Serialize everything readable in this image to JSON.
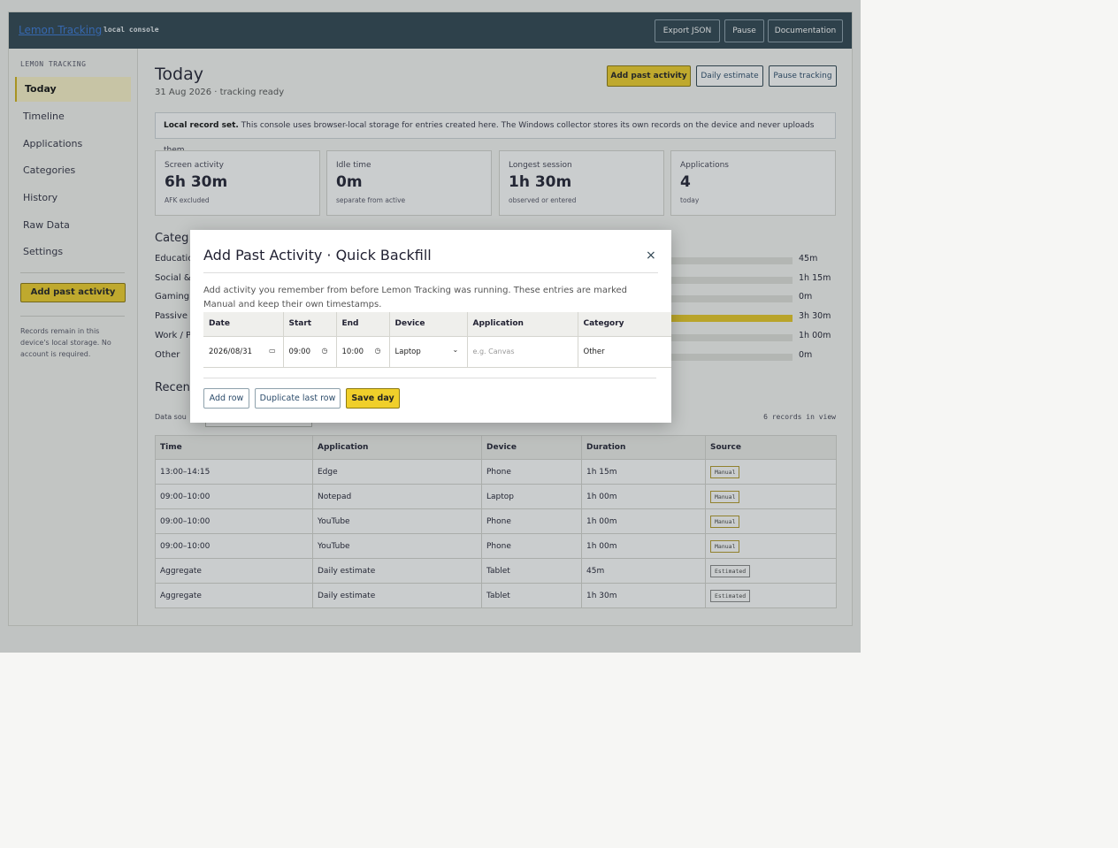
{
  "topbar": {
    "brand": "Lemon Tracking",
    "subtitle": "local console",
    "buttons": [
      "Export JSON",
      "Pause",
      "Documentation"
    ]
  },
  "sidebar": {
    "title": "LEMON TRACKING",
    "items": [
      {
        "label": "Today",
        "active": true
      },
      {
        "label": "Timeline"
      },
      {
        "label": "Applications"
      },
      {
        "label": "Categories"
      },
      {
        "label": "History"
      },
      {
        "label": "Raw Data"
      },
      {
        "label": "Settings"
      }
    ],
    "cta": "Add past activity",
    "note": "Records remain in this device's local storage. No account is required."
  },
  "header": {
    "title": "Today",
    "subtitle": "31 Aug 2026 · tracking ready",
    "buttons": [
      "Add past activity",
      "Daily estimate",
      "Pause tracking"
    ]
  },
  "notice": {
    "bold": "Local record set.",
    "text": " This console uses browser-local storage for entries created here. The Windows collector stores its own records on the device and never uploads them."
  },
  "stats": [
    {
      "label": "Screen activity",
      "value": "6h 30m",
      "sub": "AFK excluded"
    },
    {
      "label": "Idle time",
      "value": "0m",
      "sub": "separate from active"
    },
    {
      "label": "Longest session",
      "value": "1h 30m",
      "sub": "observed or entered"
    },
    {
      "label": "Applications",
      "value": "4",
      "sub": "today"
    }
  ],
  "categories": {
    "title": "Categ",
    "rows": [
      {
        "name": "Educatio",
        "amount": "45m",
        "fraction": 0
      },
      {
        "name": "Social &",
        "amount": "1h 15m",
        "fraction": 0
      },
      {
        "name": "Gaming",
        "amount": "0m",
        "fraction": 0
      },
      {
        "name": "Passive E",
        "amount": "3h 30m",
        "fraction": 1
      },
      {
        "name": "Work / P",
        "amount": "1h 00m",
        "fraction": 0
      },
      {
        "name": "Other",
        "amount": "0m",
        "fraction": 0
      }
    ]
  },
  "recent": {
    "title": "Recen",
    "filter_label": "Data sou",
    "count": "6 records in view",
    "columns": [
      "Time",
      "Application",
      "Device",
      "Duration",
      "Source"
    ],
    "rows": [
      [
        "13:00–14:15",
        "Edge",
        "Phone",
        "1h 15m",
        "Manual"
      ],
      [
        "09:00–10:00",
        "Notepad",
        "Laptop",
        "1h 00m",
        "Manual"
      ],
      [
        "09:00–10:00",
        "YouTube",
        "Phone",
        "1h 00m",
        "Manual"
      ],
      [
        "09:00–10:00",
        "YouTube",
        "Phone",
        "1h 00m",
        "Manual"
      ],
      [
        "Aggregate",
        "Daily estimate",
        "Tablet",
        "45m",
        "Estimated"
      ],
      [
        "Aggregate",
        "Daily estimate",
        "Tablet",
        "1h 30m",
        "Estimated"
      ]
    ]
  },
  "modal": {
    "title": "Add Past Activity · Quick Backfill",
    "close": "×",
    "description": "Add activity you remember from before Lemon Tracking was running. These entries are marked Manual and keep their own timestamps.",
    "columns": [
      "Date",
      "Start",
      "End",
      "Device",
      "Application",
      "Category"
    ],
    "row": {
      "date": "2026/08/31",
      "start": "09:00",
      "end": "10:00",
      "device": "Laptop",
      "application_placeholder": "e.g. Canvas",
      "category": "Other"
    },
    "buttons": {
      "add_row": "Add row",
      "duplicate": "Duplicate last row",
      "save": "Save day"
    }
  }
}
